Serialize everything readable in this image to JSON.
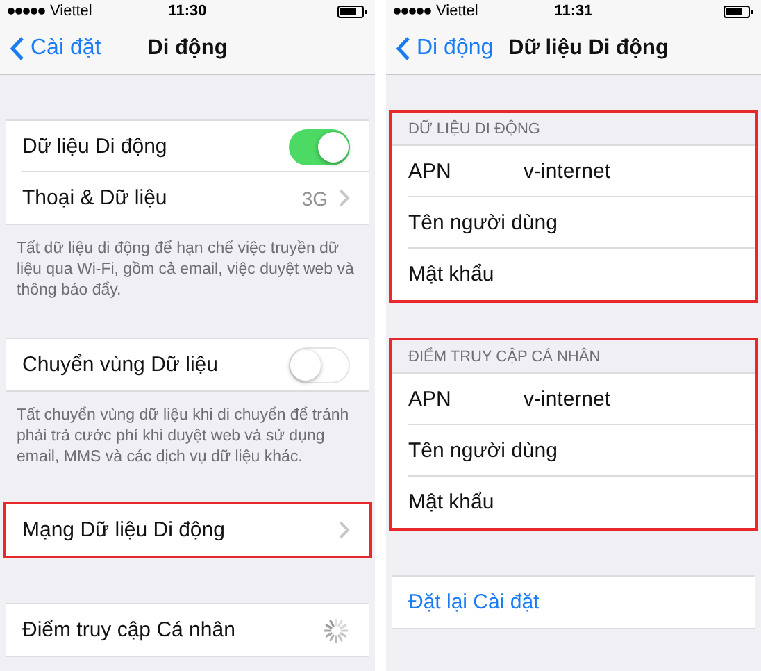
{
  "screens": [
    {
      "status_bar": {
        "carrier": "Viettel",
        "time": "11:30"
      },
      "nav": {
        "back": "Cài đặt",
        "title": "Di động"
      },
      "groups": [
        {
          "highlighted": false,
          "rows": [
            {
              "kind": "toggle",
              "label": "Dữ liệu Di động",
              "on": true
            },
            {
              "kind": "detail",
              "label": "Thoại & Dữ liệu",
              "value": "3G"
            }
          ],
          "footer": "Tất dữ liệu di động để hạn chế việc truyền dữ liệu qua Wi-Fi, gồm cả email, việc duyệt web và thông báo đẩy."
        },
        {
          "highlighted": false,
          "rows": [
            {
              "kind": "toggle",
              "label": "Chuyển vùng Dữ liệu",
              "on": false
            }
          ],
          "footer": "Tất chuyển vùng dữ liệu khi di chuyển để tránh phải trả cước phí khi duyệt web và sử dụng email, MMS và các dịch vụ dữ liệu khác."
        },
        {
          "highlighted": true,
          "rows": [
            {
              "kind": "nav",
              "label": "Mạng Dữ liệu Di động"
            }
          ]
        },
        {
          "highlighted": false,
          "rows": [
            {
              "kind": "spinner",
              "label": "Điểm truy cập Cá nhân"
            }
          ]
        }
      ]
    },
    {
      "status_bar": {
        "carrier": "Viettel",
        "time": "11:31"
      },
      "nav": {
        "back": "Di động",
        "title": "Dữ liệu Di động"
      },
      "groups": [
        {
          "highlighted": true,
          "header": "DỮ LIỆU DI ĐỘNG",
          "rows": [
            {
              "kind": "field",
              "label": "APN",
              "value": "v-internet"
            },
            {
              "kind": "field",
              "label": "Tên người dùng"
            },
            {
              "kind": "field",
              "label": "Mật khẩu"
            }
          ]
        },
        {
          "highlighted": true,
          "header": "ĐIỂM TRUY CẬP CÁ NHÂN",
          "rows": [
            {
              "kind": "field",
              "label": "APN",
              "value": "v-internet"
            },
            {
              "kind": "field",
              "label": "Tên người dùng"
            },
            {
              "kind": "field",
              "label": "Mật khẩu"
            }
          ]
        },
        {
          "highlighted": false,
          "rows": [
            {
              "kind": "action",
              "label": "Đặt lại Cài đặt"
            }
          ]
        }
      ]
    }
  ]
}
